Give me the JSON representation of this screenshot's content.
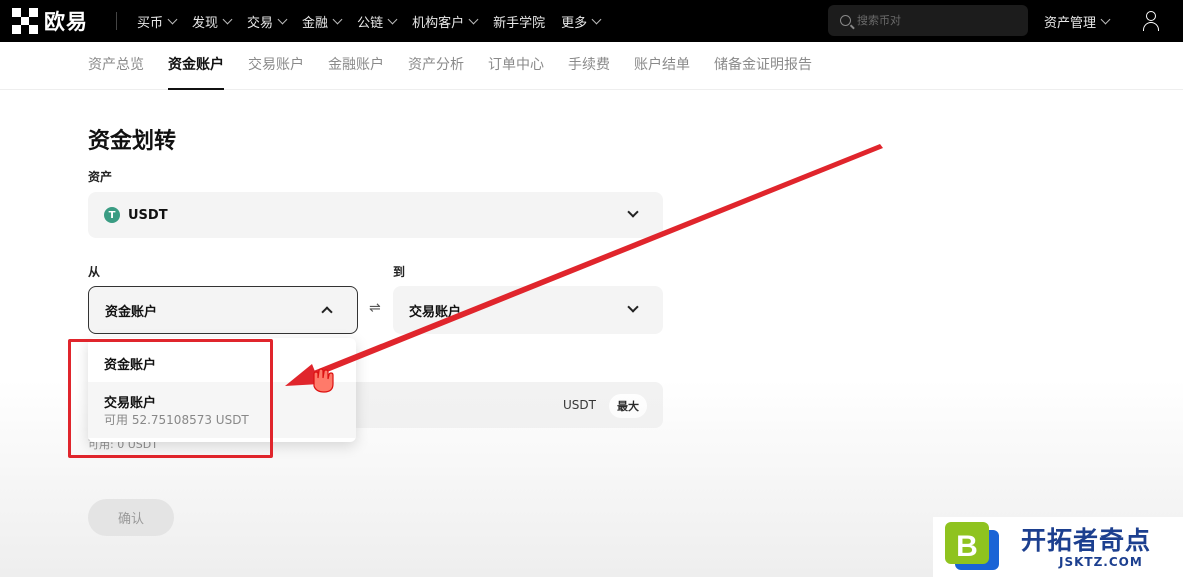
{
  "topnav": {
    "logo_text": "欧易",
    "items": [
      "买币",
      "发现",
      "交易",
      "金融",
      "公链",
      "机构客户",
      "新手学院",
      "更多"
    ],
    "search_placeholder": "搜索币对",
    "asset_management": "资产管理"
  },
  "subnav": {
    "items": [
      "资产总览",
      "资金账户",
      "交易账户",
      "金融账户",
      "资产分析",
      "订单中心",
      "手续费",
      "账户结单",
      "储备金证明报告"
    ],
    "active": "资金账户"
  },
  "page": {
    "title": "资金划转",
    "asset_label": "资产",
    "asset_value": "USDT",
    "coin_letter": "T",
    "from_label": "从",
    "from_value": "资金账户",
    "to_label": "到",
    "to_value": "交易账户",
    "amount_unit": "USDT",
    "max_label": "最大",
    "available_text": "可用: 0 USDT",
    "confirm_label": "确认"
  },
  "dropdown": {
    "options": [
      {
        "label": "资金账户"
      },
      {
        "label": "交易账户",
        "sub": "可用 52.75108573 USDT"
      }
    ]
  },
  "annotation": {
    "arrow_color": "#e0252c",
    "box_color": "#e0252c"
  },
  "brand": {
    "title": "开拓者奇点",
    "sub": "JSKTZ.COM",
    "logo_letter": "B"
  }
}
